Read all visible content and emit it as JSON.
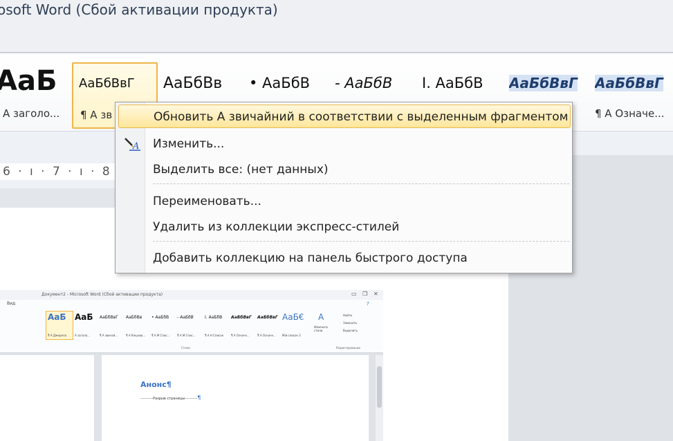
{
  "window": {
    "title": "osoft Word (Сбой активации продукта)"
  },
  "ribbon": {
    "styles": [
      {
        "sample": "АаБ",
        "label": "А заголо..."
      },
      {
        "sample": "АаБбВвГ",
        "label": "¶ А зв"
      },
      {
        "sample": "АаБбВв",
        "label": ""
      },
      {
        "sample": "• АаБбВ",
        "label": ""
      },
      {
        "sample": "- АаБбВ",
        "label": ""
      },
      {
        "sample": "I. АаБбВ",
        "label": ""
      },
      {
        "sample": "АаБбВвГ",
        "label": ""
      },
      {
        "sample": "АаБбВвГ",
        "label": "¶ А Означе..."
      }
    ]
  },
  "ruler": {
    "text": "6 · ı · 7 · ı · 8 ·"
  },
  "context_menu": {
    "items": {
      "update": "Обновить А звичайний в соответствии с выделенным фрагментом",
      "edit": "Изменить...",
      "select_all": "Выделить все: (нет данных)",
      "rename": "Переименовать...",
      "remove": "Удалить из коллекции экспресс-стилей",
      "add_qat": "Добавить коллекцию на панель быстрого доступа"
    }
  },
  "embedded_screenshot": {
    "title": "Документ2 - Microsoft Word (Сбой активации продукта)",
    "tab": "Вид",
    "styles": [
      {
        "sample": "АаБ",
        "label": "¶ А Джерела"
      },
      {
        "sample": "АаБ",
        "label": "А заголо..."
      },
      {
        "sample": "АаБбВвГ",
        "label": "¶ А звичай..."
      },
      {
        "sample": "АаБбВв",
        "label": "¶ А Кінцева..."
      },
      {
        "sample": "• АаБбВ",
        "label": "¶ А М Спис..."
      },
      {
        "sample": "- АаБбВ",
        "label": "¶ А М Спис..."
      },
      {
        "sample": "I. АаБбВ",
        "label": "¶ А Н Список"
      },
      {
        "sample": "АаБбВвГ",
        "label": "¶ А Означе..."
      },
      {
        "sample": "АаБбВвГ",
        "label": "¶ А Означе..."
      },
      {
        "sample": "АаБбВвГ",
        "label": "¶ А Означе..."
      },
      {
        "sample": "АаБ€",
        "label": "Мій список 3"
      }
    ],
    "change_styles": "Изменить стили",
    "find": "Найти",
    "replace": "Заменить",
    "select": "Выделить",
    "group_styles": "Стили",
    "group_editing": "Редактирование",
    "heading": "Анонс¶",
    "page_break": "Разрыв страницы"
  },
  "colors": {
    "menu_highlight": "#ffe69a",
    "selected_style_border": "#f0b44a",
    "heading_blue": "#3a74c4"
  }
}
